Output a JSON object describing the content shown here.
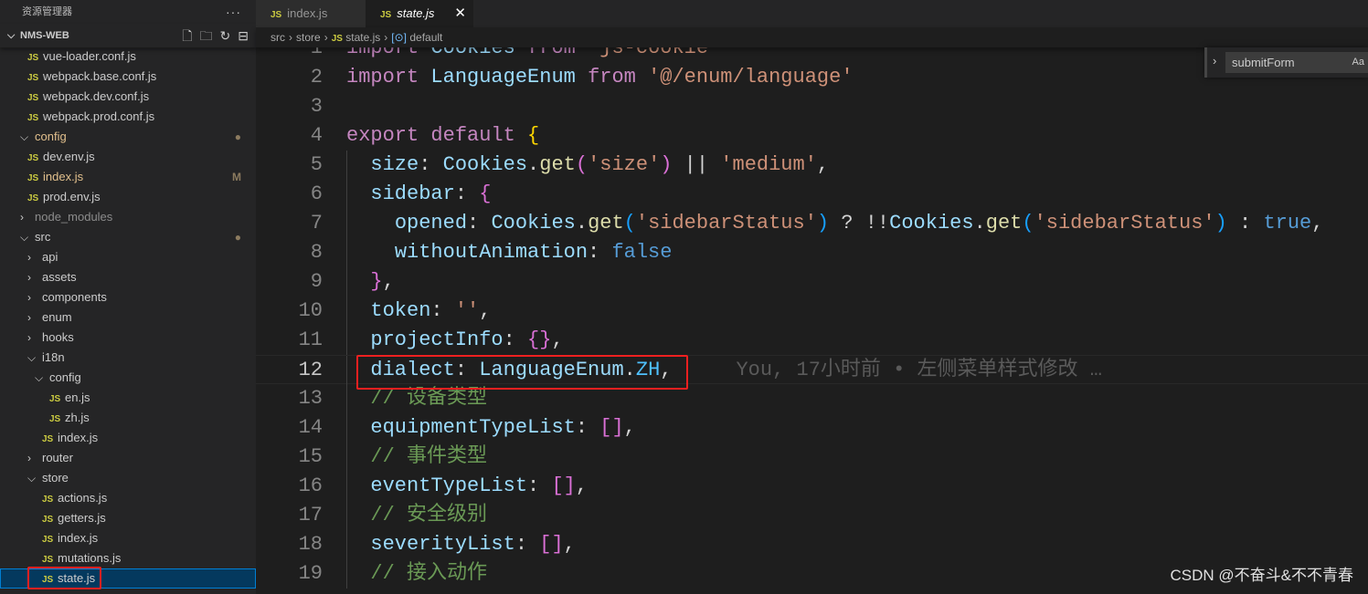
{
  "sidebar": {
    "title": "资源管理器",
    "more": "···",
    "project": "NMS-WEB",
    "actions": [
      {
        "name": "new-file-icon",
        "glyph": "🗋"
      },
      {
        "name": "new-folder-icon",
        "glyph": "🗀"
      },
      {
        "name": "refresh-icon",
        "glyph": "↻"
      },
      {
        "name": "collapse-all-icon",
        "glyph": "⊟"
      }
    ],
    "tree": [
      {
        "label": "vue-loader.conf.js",
        "type": "file",
        "depth": 0
      },
      {
        "label": "webpack.base.conf.js",
        "type": "file",
        "depth": 0
      },
      {
        "label": "webpack.dev.conf.js",
        "type": "file",
        "depth": 0
      },
      {
        "label": "webpack.prod.conf.js",
        "type": "file",
        "depth": 0
      },
      {
        "label": "config",
        "type": "folder",
        "open": true,
        "depth": 0,
        "badge": "●",
        "status": "modified"
      },
      {
        "label": "dev.env.js",
        "type": "file",
        "depth": 0
      },
      {
        "label": "index.js",
        "type": "file",
        "depth": 0,
        "badge": "M",
        "status": "modified"
      },
      {
        "label": "prod.env.js",
        "type": "file",
        "depth": 0
      },
      {
        "label": "node_modules",
        "type": "folder",
        "open": false,
        "depth": 0,
        "status": "dim"
      },
      {
        "label": "src",
        "type": "folder",
        "open": true,
        "depth": 0,
        "badge": "●"
      },
      {
        "label": "api",
        "type": "folder",
        "open": false,
        "depth": 1
      },
      {
        "label": "assets",
        "type": "folder",
        "open": false,
        "depth": 1
      },
      {
        "label": "components",
        "type": "folder",
        "open": false,
        "depth": 1
      },
      {
        "label": "enum",
        "type": "folder",
        "open": false,
        "depth": 1
      },
      {
        "label": "hooks",
        "type": "folder",
        "open": false,
        "depth": 1
      },
      {
        "label": "i18n",
        "type": "folder",
        "open": true,
        "depth": 1
      },
      {
        "label": "config",
        "type": "folder",
        "open": true,
        "depth": 2
      },
      {
        "label": "en.js",
        "type": "file",
        "depth": 3
      },
      {
        "label": "zh.js",
        "type": "file",
        "depth": 3
      },
      {
        "label": "index.js",
        "type": "file",
        "depth": 2
      },
      {
        "label": "router",
        "type": "folder",
        "open": false,
        "depth": 1
      },
      {
        "label": "store",
        "type": "folder",
        "open": true,
        "depth": 1
      },
      {
        "label": "actions.js",
        "type": "file",
        "depth": 2
      },
      {
        "label": "getters.js",
        "type": "file",
        "depth": 2
      },
      {
        "label": "index.js",
        "type": "file",
        "depth": 2
      },
      {
        "label": "mutations.js",
        "type": "file",
        "depth": 2
      },
      {
        "label": "state.js",
        "type": "file",
        "depth": 2,
        "selected": true
      }
    ]
  },
  "tabs": [
    {
      "label": "index.js",
      "active": false
    },
    {
      "label": "state.js",
      "active": true,
      "close": "✕"
    }
  ],
  "breadcrumb": {
    "items": [
      "src",
      "store",
      "state.js",
      "default"
    ],
    "symbol": "[⊙]"
  },
  "find": {
    "value": "submitForm",
    "case_toggle": "Aa"
  },
  "file_icon": "JS",
  "current_line": 12,
  "blame": "You, 17小时前 • 左侧菜单样式修改 …",
  "code": [
    [
      [
        "import",
        "k"
      ],
      [
        " ",
        "p"
      ],
      [
        "Cookies",
        "v"
      ],
      [
        " ",
        "p"
      ],
      [
        "from",
        "k"
      ],
      [
        " ",
        "p"
      ],
      [
        "'js-cookie'",
        "s"
      ]
    ],
    [
      [
        "import",
        "k"
      ],
      [
        " ",
        "p"
      ],
      [
        "LanguageEnum",
        "v"
      ],
      [
        " ",
        "p"
      ],
      [
        "from",
        "k"
      ],
      [
        " ",
        "p"
      ],
      [
        "'@/enum/language'",
        "s"
      ]
    ],
    [],
    [
      [
        "export",
        "k"
      ],
      [
        " ",
        "p"
      ],
      [
        "default",
        "k"
      ],
      [
        " ",
        "p"
      ],
      [
        "{",
        "y"
      ]
    ],
    [
      [
        "  ",
        "p"
      ],
      [
        "size",
        "v"
      ],
      [
        ": ",
        "p"
      ],
      [
        "Cookies",
        "v"
      ],
      [
        ".",
        "p"
      ],
      [
        "get",
        "f"
      ],
      [
        "(",
        "m"
      ],
      [
        "'size'",
        "s"
      ],
      [
        ")",
        "m"
      ],
      [
        " || ",
        "p"
      ],
      [
        "'medium'",
        "s"
      ],
      [
        ",",
        "p"
      ]
    ],
    [
      [
        "  ",
        "p"
      ],
      [
        "sidebar",
        "v"
      ],
      [
        ": ",
        "p"
      ],
      [
        "{",
        "m"
      ]
    ],
    [
      [
        "    ",
        "p"
      ],
      [
        "opened",
        "v"
      ],
      [
        ": ",
        "p"
      ],
      [
        "Cookies",
        "v"
      ],
      [
        ".",
        "p"
      ],
      [
        "get",
        "f"
      ],
      [
        "(",
        "u"
      ],
      [
        "'sidebarStatus'",
        "s"
      ],
      [
        ")",
        "u"
      ],
      [
        " ? !!",
        "p"
      ],
      [
        "Cookies",
        "v"
      ],
      [
        ".",
        "p"
      ],
      [
        "get",
        "f"
      ],
      [
        "(",
        "u"
      ],
      [
        "'sidebarStatus'",
        "s"
      ],
      [
        ")",
        "u"
      ],
      [
        " : ",
        "p"
      ],
      [
        "true",
        "b"
      ],
      [
        ",",
        "p"
      ]
    ],
    [
      [
        "    ",
        "p"
      ],
      [
        "withoutAnimation",
        "v"
      ],
      [
        ": ",
        "p"
      ],
      [
        "false",
        "b"
      ]
    ],
    [
      [
        "  ",
        "p"
      ],
      [
        "}",
        "m"
      ],
      [
        ",",
        "p"
      ]
    ],
    [
      [
        "  ",
        "p"
      ],
      [
        "token",
        "v"
      ],
      [
        ": ",
        "p"
      ],
      [
        "''",
        "s"
      ],
      [
        ",",
        "p"
      ]
    ],
    [
      [
        "  ",
        "p"
      ],
      [
        "projectInfo",
        "v"
      ],
      [
        ": ",
        "p"
      ],
      [
        "{}",
        "m"
      ],
      [
        ",",
        "p"
      ]
    ],
    [
      [
        "  ",
        "p"
      ],
      [
        "dialect",
        "v"
      ],
      [
        ": ",
        "p"
      ],
      [
        "LanguageEnum",
        "v"
      ],
      [
        ".",
        "p"
      ],
      [
        "ZH",
        "cn"
      ],
      [
        ",",
        "p"
      ]
    ],
    [
      [
        "  ",
        "p"
      ],
      [
        "// 设备类型",
        "c"
      ]
    ],
    [
      [
        "  ",
        "p"
      ],
      [
        "equipmentTypeList",
        "v"
      ],
      [
        ": ",
        "p"
      ],
      [
        "[]",
        "m"
      ],
      [
        ",",
        "p"
      ]
    ],
    [
      [
        "  ",
        "p"
      ],
      [
        "// 事件类型",
        "c"
      ]
    ],
    [
      [
        "  ",
        "p"
      ],
      [
        "eventTypeList",
        "v"
      ],
      [
        ": ",
        "p"
      ],
      [
        "[]",
        "m"
      ],
      [
        ",",
        "p"
      ]
    ],
    [
      [
        "  ",
        "p"
      ],
      [
        "// 安全级别",
        "c"
      ]
    ],
    [
      [
        "  ",
        "p"
      ],
      [
        "severityList",
        "v"
      ],
      [
        ": ",
        "p"
      ],
      [
        "[]",
        "m"
      ],
      [
        ",",
        "p"
      ]
    ],
    [
      [
        "  ",
        "p"
      ],
      [
        "// 接入动作",
        "c"
      ]
    ]
  ],
  "watermark": "CSDN @不奋斗&不不青春"
}
